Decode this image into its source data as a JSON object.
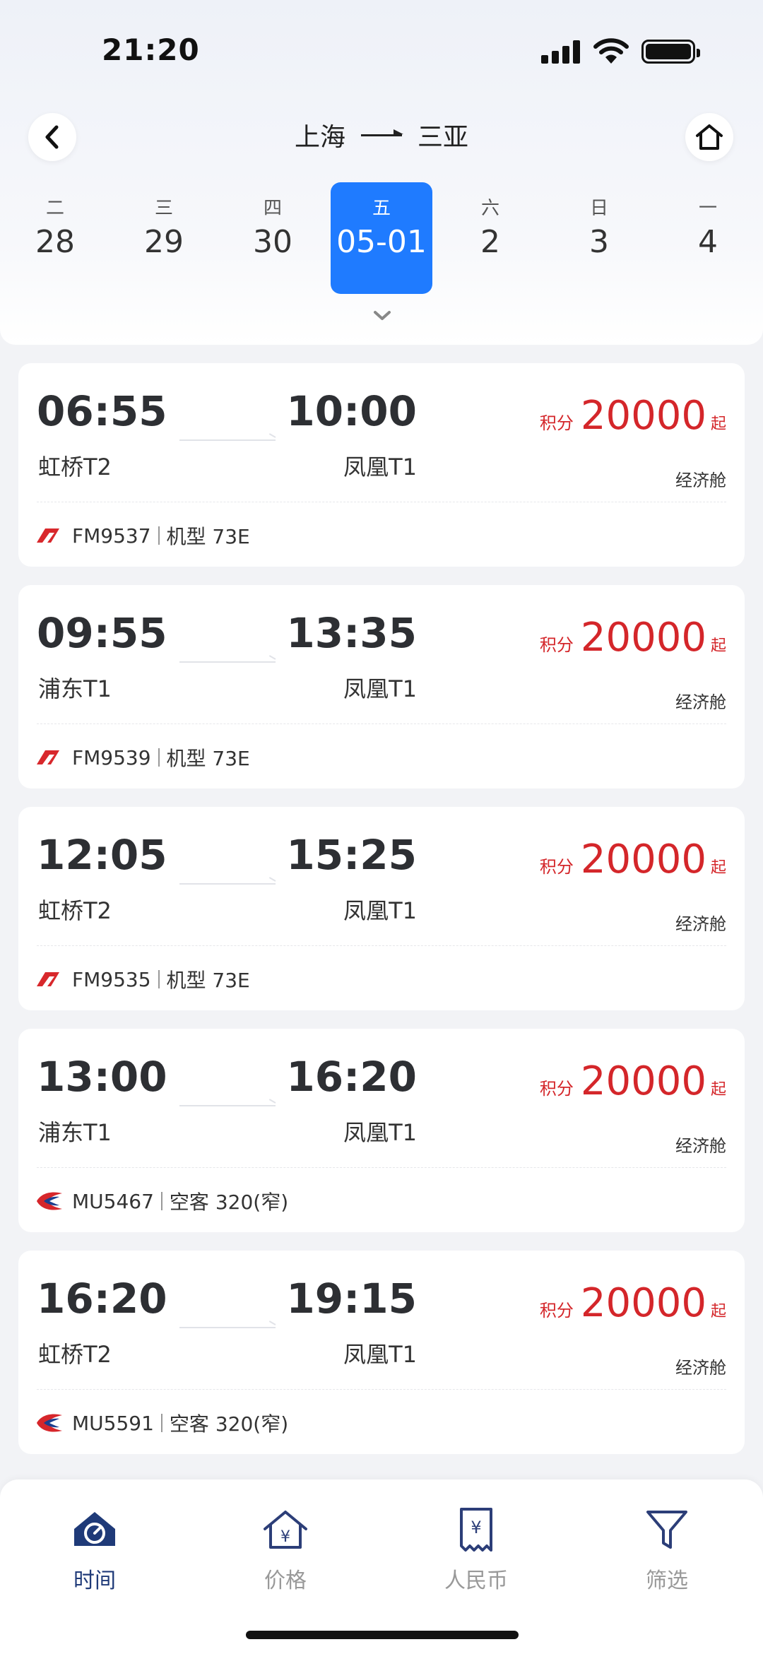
{
  "status_bar": {
    "time": "21:20"
  },
  "route": {
    "from": "上海",
    "to": "三亚"
  },
  "dates": [
    {
      "weekday": "二",
      "day": "28"
    },
    {
      "weekday": "三",
      "day": "29"
    },
    {
      "weekday": "四",
      "day": "30"
    },
    {
      "weekday": "五",
      "day": "05-01",
      "active": true
    },
    {
      "weekday": "六",
      "day": "2"
    },
    {
      "weekday": "日",
      "day": "3"
    },
    {
      "weekday": "一",
      "day": "4"
    }
  ],
  "flights": [
    {
      "dep_time": "06:55",
      "dep_terminal": "虹桥T2",
      "arr_time": "10:00",
      "arr_terminal": "凤凰T1",
      "price_label": "积分",
      "price": "20000",
      "price_suffix": "起",
      "cabin": "经济舱",
      "flight_no": "FM9537",
      "aircraft": "机型 73E",
      "airline": "shanghai-airlines"
    },
    {
      "dep_time": "09:55",
      "dep_terminal": "浦东T1",
      "arr_time": "13:35",
      "arr_terminal": "凤凰T1",
      "price_label": "积分",
      "price": "20000",
      "price_suffix": "起",
      "cabin": "经济舱",
      "flight_no": "FM9539",
      "aircraft": "机型 73E",
      "airline": "shanghai-airlines"
    },
    {
      "dep_time": "12:05",
      "dep_terminal": "虹桥T2",
      "arr_time": "15:25",
      "arr_terminal": "凤凰T1",
      "price_label": "积分",
      "price": "20000",
      "price_suffix": "起",
      "cabin": "经济舱",
      "flight_no": "FM9535",
      "aircraft": "机型 73E",
      "airline": "shanghai-airlines"
    },
    {
      "dep_time": "13:00",
      "dep_terminal": "浦东T1",
      "arr_time": "16:20",
      "arr_terminal": "凤凰T1",
      "price_label": "积分",
      "price": "20000",
      "price_suffix": "起",
      "cabin": "经济舱",
      "flight_no": "MU5467",
      "aircraft": "空客 320(窄)",
      "airline": "china-eastern"
    },
    {
      "dep_time": "16:20",
      "dep_terminal": "虹桥T2",
      "arr_time": "19:15",
      "arr_terminal": "凤凰T1",
      "price_label": "积分",
      "price": "20000",
      "price_suffix": "起",
      "cabin": "经济舱",
      "flight_no": "MU5591",
      "aircraft": "空客 320(窄)",
      "airline": "china-eastern"
    }
  ],
  "tabs": [
    {
      "label": "时间",
      "icon": "clock-home-icon",
      "active": true
    },
    {
      "label": "价格",
      "icon": "price-house-icon"
    },
    {
      "label": "人民币",
      "icon": "rmb-receipt-icon"
    },
    {
      "label": "筛选",
      "icon": "filter-icon"
    }
  ],
  "colors": {
    "accent": "#1f7bff",
    "price": "#d4262a",
    "tab_active": "#1f3a78"
  }
}
